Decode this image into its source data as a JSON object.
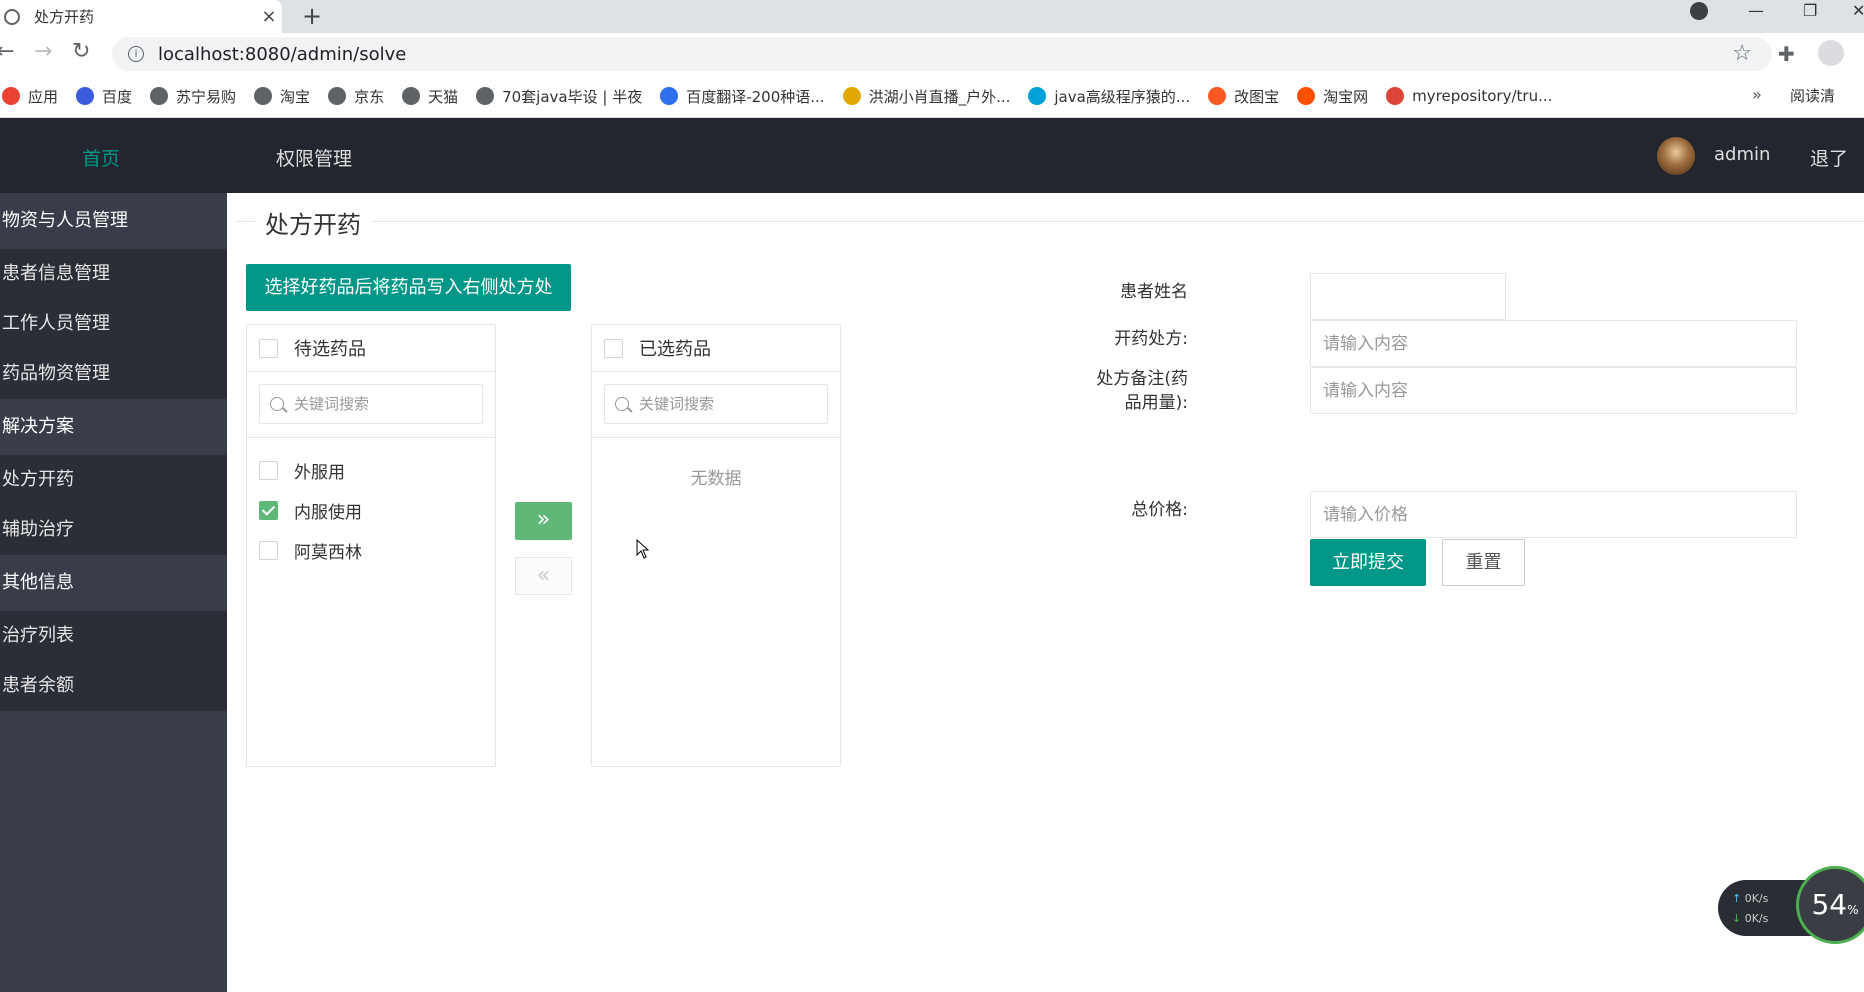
{
  "browser": {
    "tab_title": "处方开药",
    "tab_close": "×",
    "new_tab": "+",
    "url": "localhost:8080/admin/solve",
    "bookmarks": [
      {
        "label": "应用",
        "color": "#e94235"
      },
      {
        "label": "百度",
        "color": "#3b5bdb"
      },
      {
        "label": "苏宁易购",
        "color": "#5f6368"
      },
      {
        "label": "淘宝",
        "color": "#5f6368"
      },
      {
        "label": "京东",
        "color": "#5f6368"
      },
      {
        "label": "天猫",
        "color": "#5f6368"
      },
      {
        "label": "70套java毕设 | 半夜",
        "color": "#5f6368"
      },
      {
        "label": "百度翻译-200种语...",
        "color": "#2f6fed"
      },
      {
        "label": "洪湖小肖直播_户外...",
        "color": "#e0a800"
      },
      {
        "label": "java高级程序猿的...",
        "color": "#00a1d6"
      },
      {
        "label": "改图宝",
        "color": "#ff5722"
      },
      {
        "label": "淘宝网",
        "color": "#ff5000"
      },
      {
        "label": "myrepository/tru...",
        "color": "#db4437"
      }
    ],
    "bookmarks_more": "»",
    "reading_list": "阅读清"
  },
  "header": {
    "nav_home": "首页",
    "nav_permission": "权限管理",
    "username": "admin",
    "logout": "退了"
  },
  "sidebar": {
    "groups": [
      {
        "label": "物资与人员管理",
        "children": [
          "患者信息管理",
          "工作人员管理",
          "药品物资管理"
        ]
      },
      {
        "label": "解决方案",
        "children": [
          "处方开药",
          "辅助治疗"
        ]
      },
      {
        "label": "其他信息",
        "children": [
          "治疗列表",
          "患者余额"
        ]
      }
    ]
  },
  "main": {
    "page_title": "处方开药",
    "hint_button": "选择好药品后将药品写入右侧处方处",
    "transfer": {
      "left_title": "待选药品",
      "right_title": "已选药品",
      "search_placeholder": "关键词搜索",
      "left_items": [
        {
          "label": "外服用",
          "checked": false
        },
        {
          "label": "内服使用",
          "checked": true
        },
        {
          "label": "阿莫西林",
          "checked": false
        }
      ],
      "right_empty": "无数据",
      "to_right": "»",
      "to_left": "«"
    },
    "form": {
      "patient_name_label": "患者姓名",
      "patient_name_value": "",
      "prescription_label": "开药处方:",
      "prescription_placeholder": "请输入内容",
      "remark_label_line1": "处方备注(药",
      "remark_label_line2": "品用量):",
      "remark_placeholder": "请输入内容",
      "price_label": "总价格:",
      "price_placeholder": "请输入价格",
      "submit": "立即提交",
      "reset": "重置"
    }
  },
  "net_widget": {
    "up": "0K/s",
    "down": "0K/s",
    "percent": "54",
    "percent_unit": "%"
  }
}
